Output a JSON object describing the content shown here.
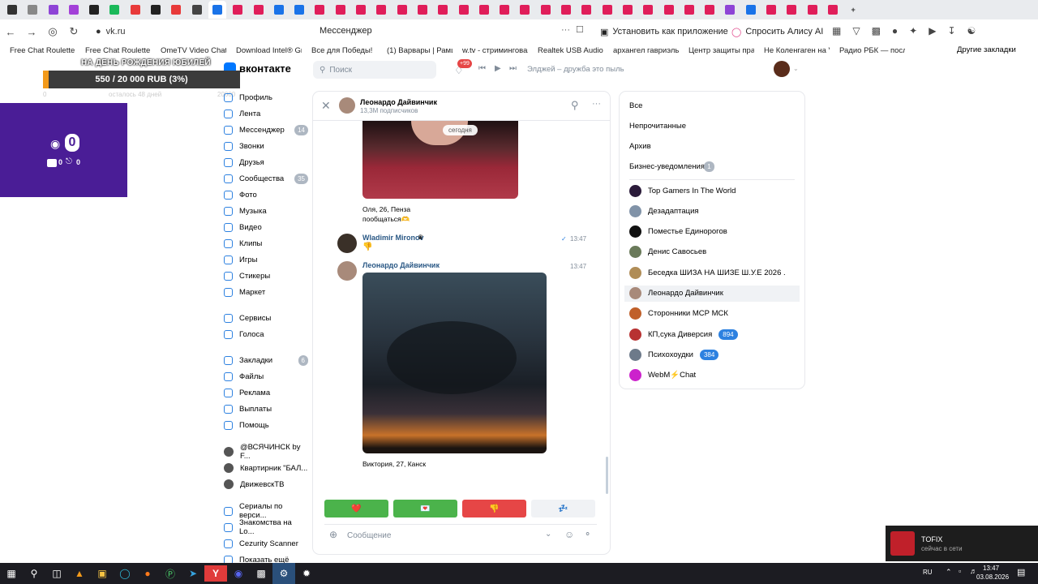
{
  "browser": {
    "tab_colors": [
      "#333333",
      "#888888",
      "#8e44d6",
      "#a341d8",
      "#222222",
      "#1bb95a",
      "#e83a3a",
      "#222222",
      "#e83a3a",
      "#444444",
      "#1a73e8",
      "#e01e5a",
      "#e01e5a",
      "#1a73e8",
      "#1a73e8",
      "#e01e5a",
      "#e01e5a",
      "#e01e5a",
      "#e01e5a",
      "#e01e5a",
      "#e01e5a",
      "#e01e5a",
      "#e01e5a",
      "#e01e5a",
      "#e01e5a",
      "#e01e5a",
      "#e01e5a",
      "#e01e5a",
      "#e01e5a",
      "#e01e5a",
      "#e01e5a",
      "#e01e5a",
      "#e01e5a",
      "#e01e5a",
      "#e01e5a",
      "#8e44d6",
      "#1a73e8",
      "#e01e5a",
      "#e01e5a",
      "#e01e5a",
      "#e01e5a"
    ],
    "url": "vk.ru",
    "page_title": "Мессенджер",
    "install_label": "Установить как приложение",
    "alice_label": "Спросить Алису AI",
    "bookmarks": [
      "Free Chat Roulette -",
      "Free Chat Roulette |",
      "OmeTV Video Chat -",
      "Download Intel® Gra",
      "Все для Победы!",
      "(1) Варвары | Рамш",
      "w.tv - стриминговая",
      "Realtek USB Audio D",
      "архангел гавриэль",
      "Центр защиты прав",
      "Не Коленгаген на Vi",
      "Радио РБК — послед"
    ],
    "other_bookmarks": "Другие закладки"
  },
  "vk": {
    "logo": "вконтакте",
    "search_placeholder": "Поиск",
    "notif_count": "+99",
    "track": "Элджей – дружба это пыль"
  },
  "overlay": {
    "goal_title": "НА ДЕНЬ РОЖДЕНИЯ ЮБИЛЕЙ",
    "goal_text": "550 / 20 000 RUB (3%)",
    "goal_progress": 0.03,
    "goal_min": "0",
    "goal_remaining": "осталось 48 дней",
    "goal_max": "20000",
    "viewers": "0",
    "yt": "0",
    "tw": "0"
  },
  "sidebar": [
    {
      "label": "Профиль",
      "count": ""
    },
    {
      "label": "Лента",
      "count": ""
    },
    {
      "label": "Мессенджер",
      "count": "14"
    },
    {
      "label": "Звонки",
      "count": ""
    },
    {
      "label": "Друзья",
      "count": ""
    },
    {
      "label": "Сообщества",
      "count": "35"
    },
    {
      "label": "Фото",
      "count": ""
    },
    {
      "label": "Музыка",
      "count": ""
    },
    {
      "label": "Видео",
      "count": ""
    },
    {
      "label": "Клипы",
      "count": ""
    },
    {
      "label": "Игры",
      "count": ""
    },
    {
      "label": "Стикеры",
      "count": ""
    },
    {
      "label": "Маркет",
      "count": ""
    }
  ],
  "sidebar2": [
    {
      "label": "Сервисы",
      "count": ""
    },
    {
      "label": "Голоса",
      "count": ""
    }
  ],
  "sidebar3": [
    {
      "label": "Закладки",
      "count": "6"
    },
    {
      "label": "Файлы",
      "count": ""
    },
    {
      "label": "Реклама",
      "count": ""
    },
    {
      "label": "Выплаты",
      "count": ""
    },
    {
      "label": "Помощь",
      "count": ""
    }
  ],
  "sidebar4": [
    "@ВСЯЧИНСК by F...",
    "Квартирник \"БАЛ...",
    "ДвижевскТВ"
  ],
  "sidebar5": [
    "Сериалы по верси...",
    "Знакомства на Lo...",
    "Cezurity Scanner",
    "Показать ещё"
  ],
  "chat": {
    "name": "Леонардо Дайвинчик",
    "subs": "13,3M подписчиков",
    "date_pill": "сегодня",
    "caption1_line1": "Оля, 26, Пенза",
    "caption1_line2": "пообщаться🫶",
    "msg2_name": "Wladimir Mironov",
    "msg2_emoji": "👎",
    "msg2_time": "13:47",
    "msg3_name": "Леонардо Дайвинчик",
    "msg3_time": "13:47",
    "caption2": "Виктория, 27, Канск",
    "buttons": [
      {
        "label": "❤️",
        "color": "#4bb34b"
      },
      {
        "label": "💌",
        "color": "#4bb34b"
      },
      {
        "label": "👎",
        "color": "#e64646"
      },
      {
        "label": "💤",
        "color": "#f0f2f5"
      }
    ],
    "compose_placeholder": "Сообщение"
  },
  "right": {
    "filters": [
      "Все",
      "Непрочитанные",
      "Архив",
      "Бизнес-уведомления"
    ],
    "biz_count": "1",
    "chats": [
      {
        "name": "Top Gamers In The World",
        "badge": "",
        "color": "#2b1b3a"
      },
      {
        "name": "Дезадаптация",
        "badge": "",
        "color": "#8193a8"
      },
      {
        "name": "Поместье Единорогов",
        "badge": "",
        "color": "#111111"
      },
      {
        "name": "Денис Савосьев",
        "badge": "",
        "color": "#6a7a5a"
      },
      {
        "name": "Беседка ШИЗА НА ШИЗЕ Ш.У.Е 2026 .",
        "badge": "",
        "color": "#b08d57"
      },
      {
        "name": "Леонардо Дайвинчик",
        "badge": "",
        "color": "#a88a7a"
      },
      {
        "name": "Сторонники МСР МСК",
        "badge": "",
        "color": "#c0602a"
      },
      {
        "name": "КП,сука Диверсия",
        "badge": "894",
        "color": "#b83232"
      },
      {
        "name": "Психохоудки",
        "badge": "384",
        "color": "#6d7a8a"
      },
      {
        "name": "WebM⚡Chat",
        "badge": "",
        "color": "#cc22cc"
      }
    ]
  },
  "toast": {
    "name": "TOFIX",
    "status": "сейчас в сети"
  },
  "taskbar": {
    "lang": "RU",
    "time": "13:47",
    "date": "03.08.2026"
  }
}
